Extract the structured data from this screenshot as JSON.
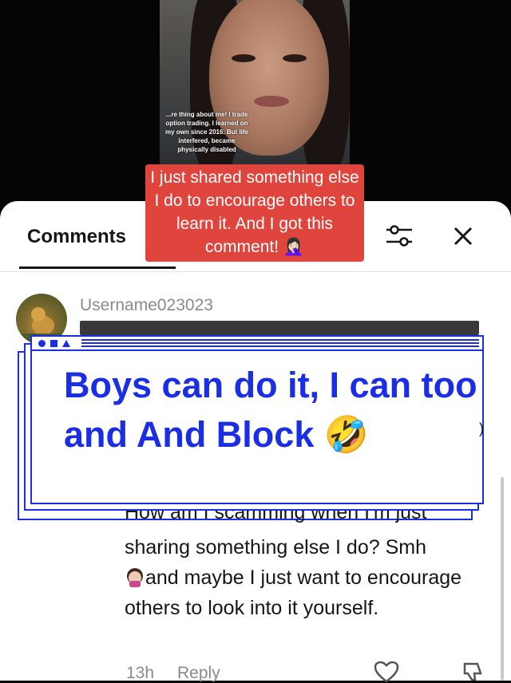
{
  "video": {
    "caption_text": "...re thing about me! I trade option trading. I learned on my own since 2016. But life interfered, became physically disabled"
  },
  "overlay_caption": "I just shared something else I do to encourage others to learn it. And I got this comment! 🤦🏻‍♀️",
  "header": {
    "tab_label": "Comments",
    "filter_icon": "sliders-icon",
    "close_icon": "close-icon"
  },
  "comment": {
    "username": "Username023023"
  },
  "overlay_window": {
    "text": "Boys can do it, I can too and And Block 🤣",
    "accent_color": "#1a2ee6"
  },
  "reply": {
    "partial_line": "How am I scamming when I'm just",
    "text_before_emoji": "sharing something else I do? Smh",
    "text_after_emoji": "and maybe I just want to encourage others to look into it yourself.",
    "time": "13h",
    "reply_label": "Reply"
  },
  "colors": {
    "caption_bg": "#e0453d",
    "muted_text": "#8a8a8a"
  }
}
